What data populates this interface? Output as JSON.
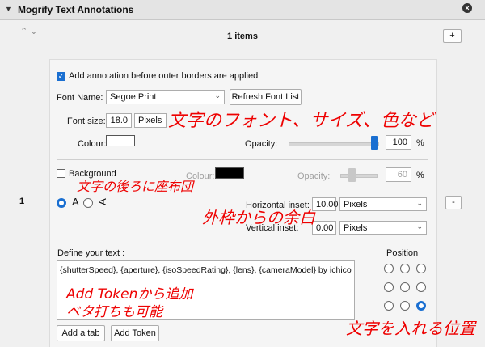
{
  "header": {
    "title": "Mogrify Text Annotations",
    "collapse_icon": "triangle-down",
    "close_icon": "close-x"
  },
  "list": {
    "count_label": "1 items",
    "reorder_up": "^",
    "reorder_down": "v",
    "add_label": "+",
    "remove_label": "-",
    "row_index": "1"
  },
  "options": {
    "before_borders_label": "Add annotation before outer borders are applied",
    "before_borders_checked": true
  },
  "font": {
    "name_label": "Font Name:",
    "name_value": "Segoe Print",
    "refresh_label": "Refresh Font List",
    "size_label": "Font size:",
    "size_value": "18.0",
    "size_unit": "Pixels",
    "colour_label": "Colour:",
    "colour_value": "#ffffff",
    "opacity_label": "Opacity:",
    "opacity_value": "100",
    "opacity_unit": "%",
    "opacity_fraction": 0.96
  },
  "background": {
    "label": "Background",
    "checked": false,
    "colour_label": "Colour:",
    "colour_value": "#000000",
    "opacity_label": "Opacity:",
    "opacity_value": "60",
    "opacity_unit": "%",
    "opacity_fraction": 0.3
  },
  "orientation": {
    "option_a": "A",
    "option_b": "A",
    "selected": "a"
  },
  "inset": {
    "horizontal_label": "Horizontal inset:",
    "horizontal_value": "10.00",
    "horizontal_unit": "Pixels",
    "vertical_label": "Vertical inset:",
    "vertical_value": "0.00",
    "vertical_unit": "Pixels"
  },
  "text": {
    "define_label": "Define your text :",
    "value": "{shutterSpeed}, {aperture}, {isoSpeedRating}, {lens}, {cameraModel} by ichico",
    "add_tab_label": "Add a tab",
    "add_token_label": "Add Token"
  },
  "position": {
    "label": "Position",
    "selected_index": 8
  },
  "annotations": {
    "font_note": "文字のフォント、サイズ、色など",
    "bg_note": "文字の後ろに座布団",
    "inset_note": "外枠からの余白",
    "token_note_1": "Add Tokenから追加",
    "token_note_2": "ベタ打ちも可能",
    "position_note": "文字を入れる位置"
  },
  "colors": {
    "accent": "#1a6fd1",
    "annotation": "#e00000"
  }
}
